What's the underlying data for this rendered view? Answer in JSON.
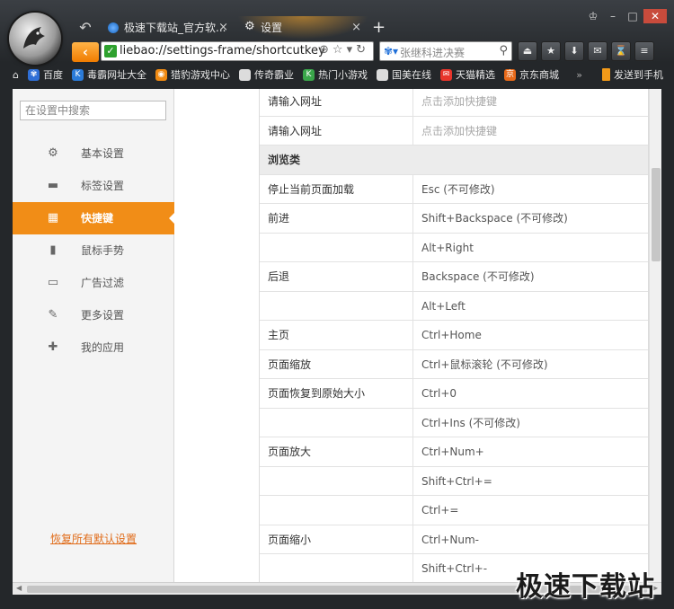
{
  "tabs": [
    {
      "title": "极速下载站_官方软...",
      "close": "×",
      "icon": "globe-icon"
    },
    {
      "title": "设置",
      "close": "×",
      "icon": "gear-icon"
    }
  ],
  "new_tab": "+",
  "window_buttons": {
    "skin": "♔",
    "minimize": "–",
    "maximize": "□",
    "close": "✕"
  },
  "address": {
    "back": "‹",
    "secure": "✓",
    "url": "liebao://settings-frame/shortcutkey",
    "icons": "⊕☆▾↻"
  },
  "search": {
    "engine_icon": "✾▾",
    "placeholder": "张继科进决赛",
    "button": "⚲"
  },
  "toolbar": [
    "⏏",
    "★",
    "⬇",
    "✉",
    "⌛",
    "≡"
  ],
  "bookmarks": [
    {
      "label": "百度",
      "color": "#2f6fd6",
      "glyph": "✾"
    },
    {
      "label": "毒霸网址大全",
      "color": "#2b7bd8",
      "glyph": "K"
    },
    {
      "label": "猎豹游戏中心",
      "color": "#f08a12",
      "glyph": "◉"
    },
    {
      "label": "传奇霸业",
      "color": "#dcdcdc",
      "glyph": ""
    },
    {
      "label": "热门小游戏",
      "color": "#3aa64a",
      "glyph": "K"
    },
    {
      "label": "国美在线",
      "color": "#dcdcdc",
      "glyph": ""
    },
    {
      "label": "天猫精选",
      "color": "#e8352b",
      "glyph": "✉"
    },
    {
      "label": "京东商城",
      "color": "#e86a1a",
      "glyph": "京"
    }
  ],
  "bookmark_more": "»",
  "send_to_phone": "发送到手机",
  "sidebar": {
    "search_placeholder": "在设置中搜索",
    "items": [
      {
        "label": "基本设置",
        "icon": "⚙"
      },
      {
        "label": "标签设置",
        "icon": "▬"
      },
      {
        "label": "快捷键",
        "icon": "▦"
      },
      {
        "label": "鼠标手势",
        "icon": "▮"
      },
      {
        "label": "广告过滤",
        "icon": "▭"
      },
      {
        "label": "更多设置",
        "icon": "✎"
      },
      {
        "label": "我的应用",
        "icon": "✚"
      }
    ],
    "active_index": 2,
    "restore_defaults": "恢复所有默认设置"
  },
  "shortcut_table": {
    "rows": [
      {
        "action": "请输入网址",
        "key": "点击添加快捷键",
        "placeholder": true
      },
      {
        "action": "请输入网址",
        "key": "点击添加快捷键",
        "placeholder": true
      },
      {
        "section": "浏览类"
      },
      {
        "action": "停止当前页面加载",
        "key": "Esc (不可修改)"
      },
      {
        "action": "前进",
        "key": "Shift+Backspace (不可修改)"
      },
      {
        "action": "",
        "key": "Alt+Right"
      },
      {
        "action": "后退",
        "key": "Backspace (不可修改)"
      },
      {
        "action": "",
        "key": "Alt+Left"
      },
      {
        "action": "主页",
        "key": "Ctrl+Home"
      },
      {
        "action": "页面缩放",
        "key": "Ctrl+鼠标滚轮 (不可修改)"
      },
      {
        "action": "页面恢复到原始大小",
        "key": "Ctrl+0"
      },
      {
        "action": "",
        "key": "Ctrl+Ins (不可修改)"
      },
      {
        "action": "页面放大",
        "key": "Ctrl+Num+"
      },
      {
        "action": "",
        "key": "Shift+Ctrl+="
      },
      {
        "action": "",
        "key": "Ctrl+="
      },
      {
        "action": "页面缩小",
        "key": "Ctrl+Num-"
      },
      {
        "action": "",
        "key": "Shift+Ctrl+-"
      }
    ]
  },
  "watermark": "极速下载站"
}
